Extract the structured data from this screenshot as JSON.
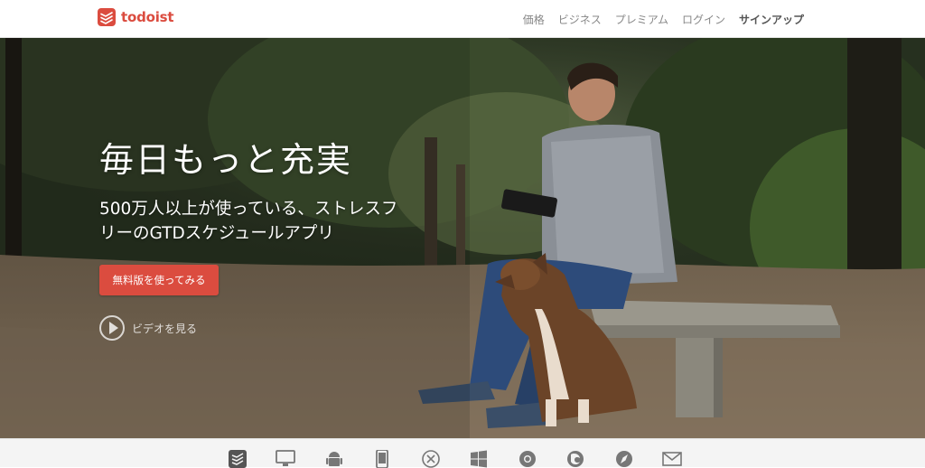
{
  "brand": {
    "name": "todoist",
    "color": "#db4c3f"
  },
  "nav": {
    "items": [
      {
        "label": "価格"
      },
      {
        "label": "ビジネス"
      },
      {
        "label": "プレミアム"
      },
      {
        "label": "ログイン"
      },
      {
        "label": "サインアップ"
      }
    ]
  },
  "hero": {
    "title": "毎日もっと充実",
    "subtitle": "500万人以上が使っている、ストレスフリーのGTDスケジュールアプリ",
    "cta_label": "無料版を使ってみる",
    "video_label": "ビデオを見る",
    "accent_color": "#db4c3f"
  },
  "platforms": {
    "icons": [
      "todoist-icon",
      "desktop-icon",
      "android-icon",
      "mobile-icon",
      "mac-os-x-icon",
      "windows-icon",
      "chrome-icon",
      "firefox-icon",
      "safari-icon",
      "email-icon"
    ]
  }
}
